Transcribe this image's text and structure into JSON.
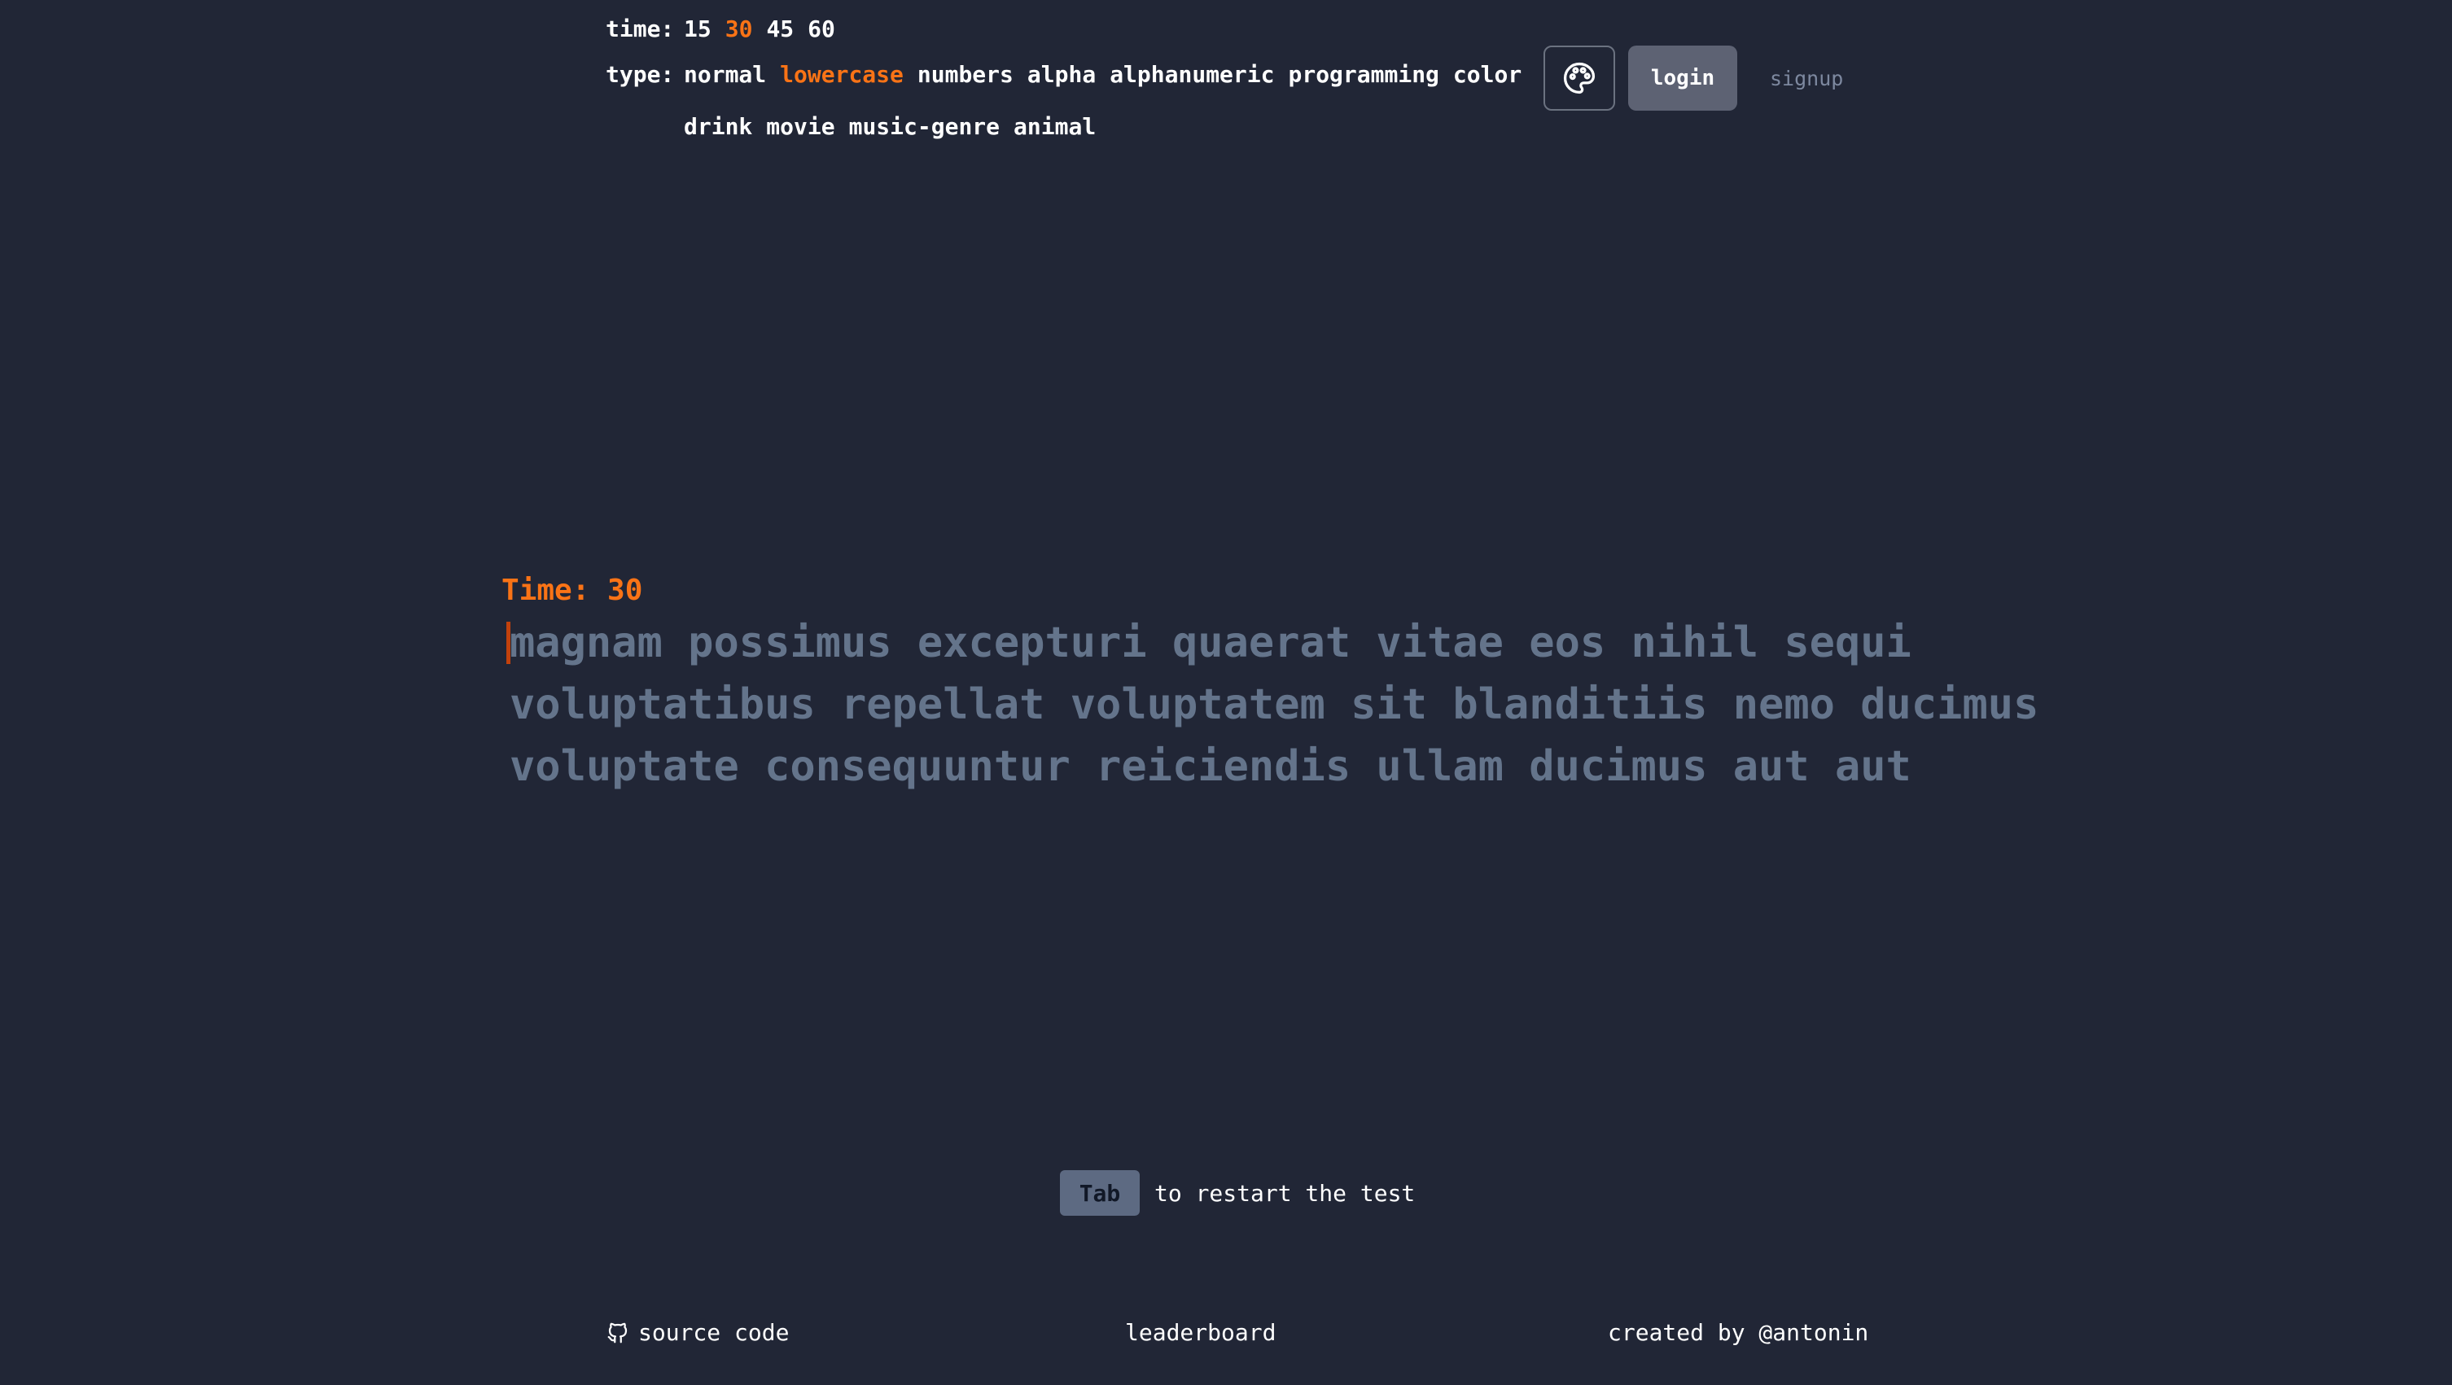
{
  "settings": {
    "time": {
      "label": "time:",
      "options": [
        "15",
        "30",
        "45",
        "60"
      ],
      "active": "30"
    },
    "type": {
      "label": "type:",
      "options": [
        "normal",
        "lowercase",
        "numbers",
        "alpha",
        "alphanumeric",
        "programming",
        "color",
        "drink",
        "movie",
        "music-genre",
        "animal"
      ],
      "active": "lowercase"
    }
  },
  "header": {
    "theme_icon": "palette-icon",
    "login_label": "login",
    "signup_label": "signup"
  },
  "test": {
    "timer_label": "Time: 30",
    "lines": [
      "magnam possimus excepturi quaerat vitae eos nihil sequi",
      "voluptatibus repellat voluptatem sit blanditiis nemo ducimus",
      "voluptate consequuntur reiciendis ullam ducimus aut aut"
    ]
  },
  "hint": {
    "key": "Tab",
    "text": "to restart the test"
  },
  "footer": {
    "source_icon": "github-icon",
    "source_label": "source code",
    "leaderboard_label": "leaderboard",
    "credit": "created by @antonin"
  },
  "colors": {
    "background": "#212636",
    "accent": "#f97316",
    "untyped_text": "#64748b",
    "caret": "#c2410c"
  }
}
